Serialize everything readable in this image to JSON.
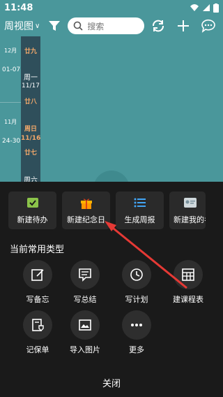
{
  "status_bar": {
    "time": "11:48"
  },
  "toolbar": {
    "view_label": "周视图",
    "search_placeholder": "搜索"
  },
  "calendar": {
    "left_rows": [
      {
        "month": "12月",
        "range": "01-07"
      },
      {
        "month": "11月",
        "range": "24-30"
      }
    ],
    "day_strip": [
      {
        "text": "廿九",
        "style": "orange"
      },
      {
        "text": "周一",
        "style": "week"
      },
      {
        "text": "11/17",
        "style": "date"
      },
      {
        "text": "廿八",
        "style": "orange"
      },
      {
        "text": "周日",
        "style": "orange"
      },
      {
        "text": "11/16",
        "style": "orange"
      },
      {
        "text": "廿七",
        "style": "orange"
      },
      {
        "text": "周六",
        "style": "week"
      }
    ]
  },
  "sheet": {
    "quick_actions": [
      {
        "label": "新建待办",
        "icon": "todo-icon",
        "color": "#8bc34a"
      },
      {
        "label": "新建纪念日",
        "icon": "gift-icon",
        "color": "#ff9800"
      },
      {
        "label": "生成周报",
        "icon": "list-icon",
        "color": "#42a5f5"
      },
      {
        "label": "新建我的名片",
        "icon": "card-icon",
        "color": "#90a4ae"
      }
    ],
    "section_title": "当前常用类型",
    "types": [
      {
        "label": "写备忘",
        "icon": "memo-icon"
      },
      {
        "label": "写总结",
        "icon": "summary-icon"
      },
      {
        "label": "写计划",
        "icon": "clock-icon"
      },
      {
        "label": "建课程表",
        "icon": "schedule-grid-icon"
      },
      {
        "label": "记保单",
        "icon": "policy-icon"
      },
      {
        "label": "导入图片",
        "icon": "image-icon"
      },
      {
        "label": "更多",
        "icon": "more-icon"
      }
    ],
    "close_label": "关闭"
  },
  "colors": {
    "header": "#4a979b",
    "sheet_bg": "#1a1a1a",
    "annotation_arrow": "#e53935"
  }
}
